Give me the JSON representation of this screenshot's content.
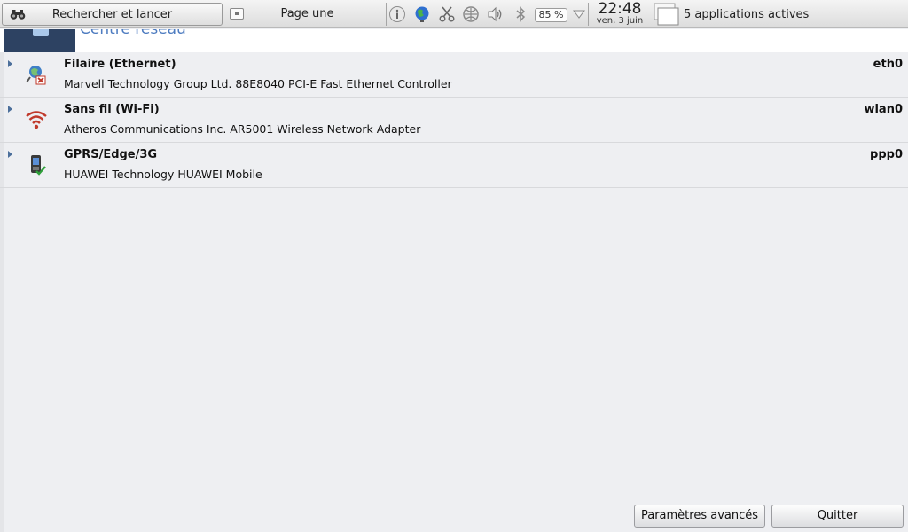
{
  "panel": {
    "search_launch_label": "Rechercher et lancer",
    "page_label": "Page une",
    "tray_icons": [
      "info-icon",
      "globe-icon",
      "scissors-icon",
      "network-icon",
      "volume-icon",
      "bluetooth-icon",
      "battery-icon"
    ],
    "battery_percent": "85 %",
    "clock_time": "22:48",
    "clock_date": "ven, 3 juin",
    "active_apps_label": "5 applications actives"
  },
  "window": {
    "title": "Centre réseau"
  },
  "connections": [
    {
      "name": "Filaire (Ethernet)",
      "description": "Marvell Technology Group Ltd. 88E8040 PCI-E Fast Ethernet Controller",
      "interface": "eth0",
      "icon": "wired-disconnected-icon"
    },
    {
      "name": "Sans fil (Wi-Fi)",
      "description": "Atheros Communications Inc. AR5001 Wireless Network Adapter",
      "interface": "wlan0",
      "icon": "wifi-icon"
    },
    {
      "name": "GPRS/Edge/3G",
      "description": "HUAWEI Technology HUAWEI Mobile",
      "interface": "ppp0",
      "icon": "mobile-broadband-icon"
    }
  ],
  "buttons": {
    "advanced_label": "Paramètres avancés",
    "quit_label": "Quitter"
  },
  "colors": {
    "header_title": "#4e7cc0",
    "header_thumb": "#2d4262",
    "background": "#eeeff2",
    "wifi": "#c0392b"
  }
}
